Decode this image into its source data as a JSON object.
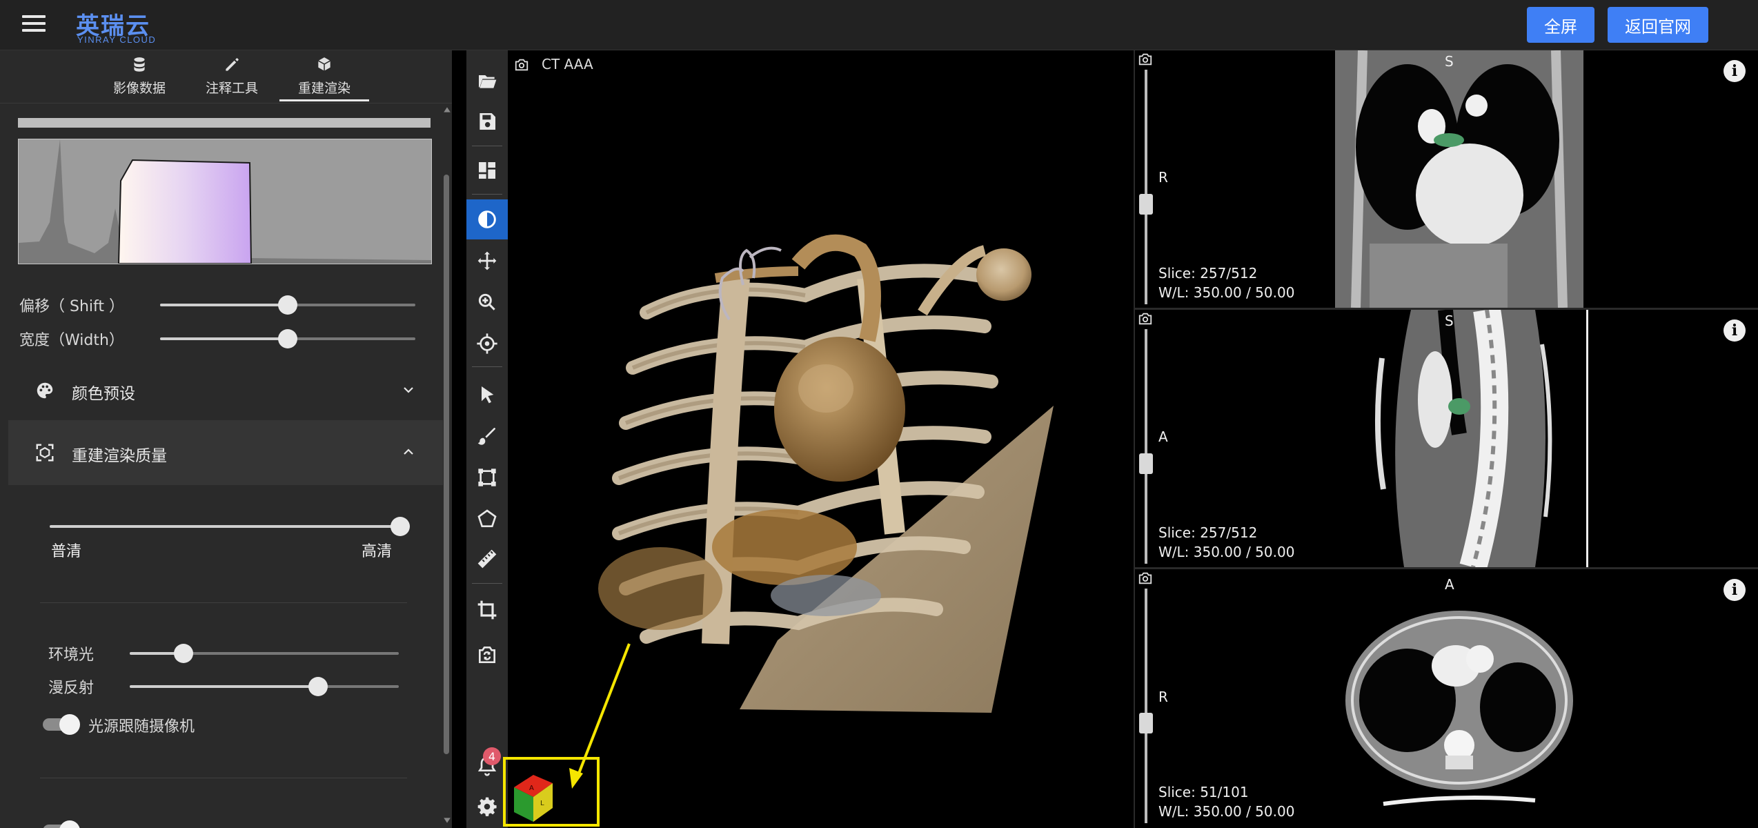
{
  "header": {
    "logo_cn": "英瑞云",
    "logo_en": "YINRAY CLOUD",
    "btn_fullscreen": "全屏",
    "btn_back": "返回官网",
    "accent": "#3f7ff5",
    "logo_color": "#5b8ff0"
  },
  "left_panel": {
    "tabs": [
      {
        "label": "影像数据",
        "icon": "database-icon"
      },
      {
        "label": "注释工具",
        "icon": "pencil-icon"
      },
      {
        "label": "重建渲染",
        "icon": "cube-icon"
      }
    ],
    "active_tab": "重建渲染",
    "shift_label": "偏移（ Shift ）",
    "shift_value": 0.5,
    "width_label": "宽度（Width）",
    "width_value": 0.5,
    "color_preset": {
      "title": "颜色预设",
      "expanded": false,
      "icon": "palette-icon"
    },
    "render_quality": {
      "title": "重建渲染质量",
      "expanded": true,
      "icon": "focus-3d-icon"
    },
    "quality_low": "普清",
    "quality_high": "高清",
    "quality_value": 1.0,
    "ambient_label": "环境光",
    "ambient_value": 0.2,
    "diffuse_label": "漫反射",
    "diffuse_value": 0.7,
    "follow_camera_label": "光源跟随摄像机",
    "follow_camera_on": true
  },
  "toolbar": {
    "tools": [
      "folder-open-icon",
      "save-icon",
      "layout-icon",
      "contrast-icon",
      "move-icon",
      "zoom-in-icon",
      "crosshair-icon",
      "pointer-icon",
      "brush-icon",
      "bounding-box-icon",
      "polygon-icon",
      "ruler-icon",
      "crop-icon",
      "camera-swap-icon"
    ],
    "active_tool": "contrast-icon",
    "notification_count": "4"
  },
  "viewports": {
    "main": {
      "title": "CT AAA"
    },
    "top": {
      "top_label": "S",
      "side_label": "R",
      "slice": "Slice: 257/512",
      "wl": "W/L: 350.00 / 50.00",
      "slider_pos": 0.48
    },
    "middle": {
      "top_label": "S",
      "side_label": "A",
      "slice": "Slice: 257/512",
      "wl": "W/L: 350.00 / 50.00",
      "slider_pos": 0.48
    },
    "bottom": {
      "top_label": "A",
      "side_label": "R",
      "slice": "Slice: 51/101",
      "wl": "W/L: 350.00 / 50.00",
      "slider_pos": 0.48
    }
  },
  "colors": {
    "panel_bg": "#2a2a2a",
    "header_bg": "#222222",
    "active_tool": "#1e66c9",
    "highlight_box": "#f5e600",
    "badge": "#e05a6b"
  }
}
